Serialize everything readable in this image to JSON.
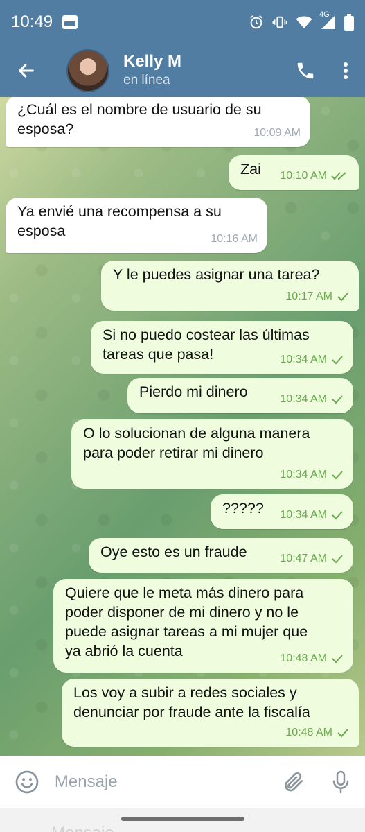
{
  "status_bar": {
    "time": "10:49",
    "network": "4G"
  },
  "header": {
    "name": "Kelly M",
    "status": "en línea"
  },
  "messages": [
    {
      "dir": "in",
      "text": "¿Cuál es el nombre de usuario de su\nesposa?",
      "time": "10:09 AM"
    },
    {
      "dir": "out",
      "text": "Zai",
      "time": "10:10 AM",
      "ticks": "double"
    },
    {
      "dir": "in",
      "text": "Ya envié una recompensa a su\nesposa",
      "time": "10:16 AM"
    },
    {
      "dir": "out",
      "text": "Y le puedes asignar una tarea?",
      "time": "10:17 AM",
      "ticks": "single"
    },
    {
      "dir": "out",
      "text": "Si no puedo costear las últimas\ntareas que pasa!",
      "time": "10:34 AM",
      "ticks": "single"
    },
    {
      "dir": "out",
      "text": "Pierdo mi dinero",
      "time": "10:34 AM",
      "ticks": "single"
    },
    {
      "dir": "out",
      "text": "O lo solucionan de alguna manera\npara poder retirar mi dinero",
      "time": "10:34 AM",
      "ticks": "single"
    },
    {
      "dir": "out",
      "text": "?????",
      "time": "10:34 AM",
      "ticks": "single"
    },
    {
      "dir": "out",
      "text": "Oye esto es un fraude",
      "time": "10:47 AM",
      "ticks": "single"
    },
    {
      "dir": "out",
      "text": "Quiere que le meta más dinero para\npoder disponer de mi dinero y no le\npuede asignar tareas a mi mujer que\nya abrió la cuenta",
      "time": "10:48 AM",
      "ticks": "single"
    },
    {
      "dir": "out",
      "text": "Los voy a subir a redes sociales y\ndenunciar por fraude ante la fiscalía",
      "time": "10:48 AM",
      "ticks": "single"
    }
  ],
  "input": {
    "placeholder": "Mensaje"
  },
  "bottom_ghost": {
    "text": "Mensaje"
  },
  "colors": {
    "header": "#527da3",
    "incoming_bubble": "#ffffff",
    "outgoing_bubble": "#effdde",
    "check": "#6aa84f"
  }
}
